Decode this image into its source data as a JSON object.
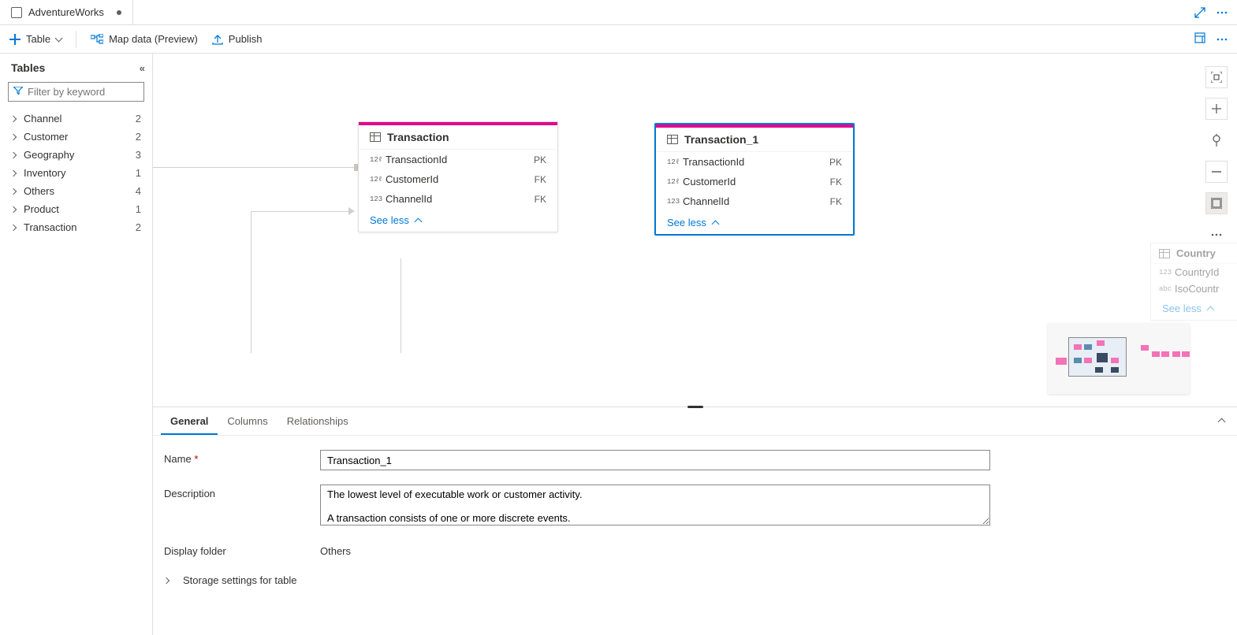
{
  "header": {
    "tab_title": "AdventureWorks"
  },
  "toolbar": {
    "table_btn": "Table",
    "mapdata_btn": "Map data (Preview)",
    "publish_btn": "Publish"
  },
  "sidebar": {
    "title": "Tables",
    "filter_placeholder": "Filter by keyword",
    "items": [
      {
        "label": "Channel",
        "count": "2"
      },
      {
        "label": "Customer",
        "count": "2"
      },
      {
        "label": "Geography",
        "count": "3"
      },
      {
        "label": "Inventory",
        "count": "1"
      },
      {
        "label": "Others",
        "count": "4"
      },
      {
        "label": "Product",
        "count": "1"
      },
      {
        "label": "Transaction",
        "count": "2"
      }
    ]
  },
  "cards": {
    "transaction": {
      "title": "Transaction",
      "cols": [
        {
          "type": "12ℓ",
          "name": "TransactionId",
          "key": "PK"
        },
        {
          "type": "12ℓ",
          "name": "CustomerId",
          "key": "FK"
        },
        {
          "type": "123",
          "name": "ChannelId",
          "key": "FK"
        }
      ],
      "see_less": "See less"
    },
    "transaction1": {
      "title": "Transaction_1",
      "cols": [
        {
          "type": "12ℓ",
          "name": "TransactionId",
          "key": "PK"
        },
        {
          "type": "12ℓ",
          "name": "CustomerId",
          "key": "FK"
        },
        {
          "type": "123",
          "name": "ChannelId",
          "key": "FK"
        }
      ],
      "see_less": "See less"
    },
    "partial": {
      "title": "Country",
      "cols": [
        {
          "type": "123",
          "name": "CountryId"
        },
        {
          "type": "abc",
          "name": "IsoCountr"
        }
      ],
      "see_less": "See less"
    }
  },
  "panel": {
    "tabs": {
      "general": "General",
      "columns": "Columns",
      "relationships": "Relationships"
    },
    "name_label": "Name",
    "name_value": "Transaction_1",
    "desc_label": "Description",
    "desc_value": "The lowest level of executable work or customer activity.\n\nA transaction consists of one or more discrete events.",
    "folder_label": "Display folder",
    "folder_value": "Others",
    "storage_label": "Storage settings for table"
  }
}
